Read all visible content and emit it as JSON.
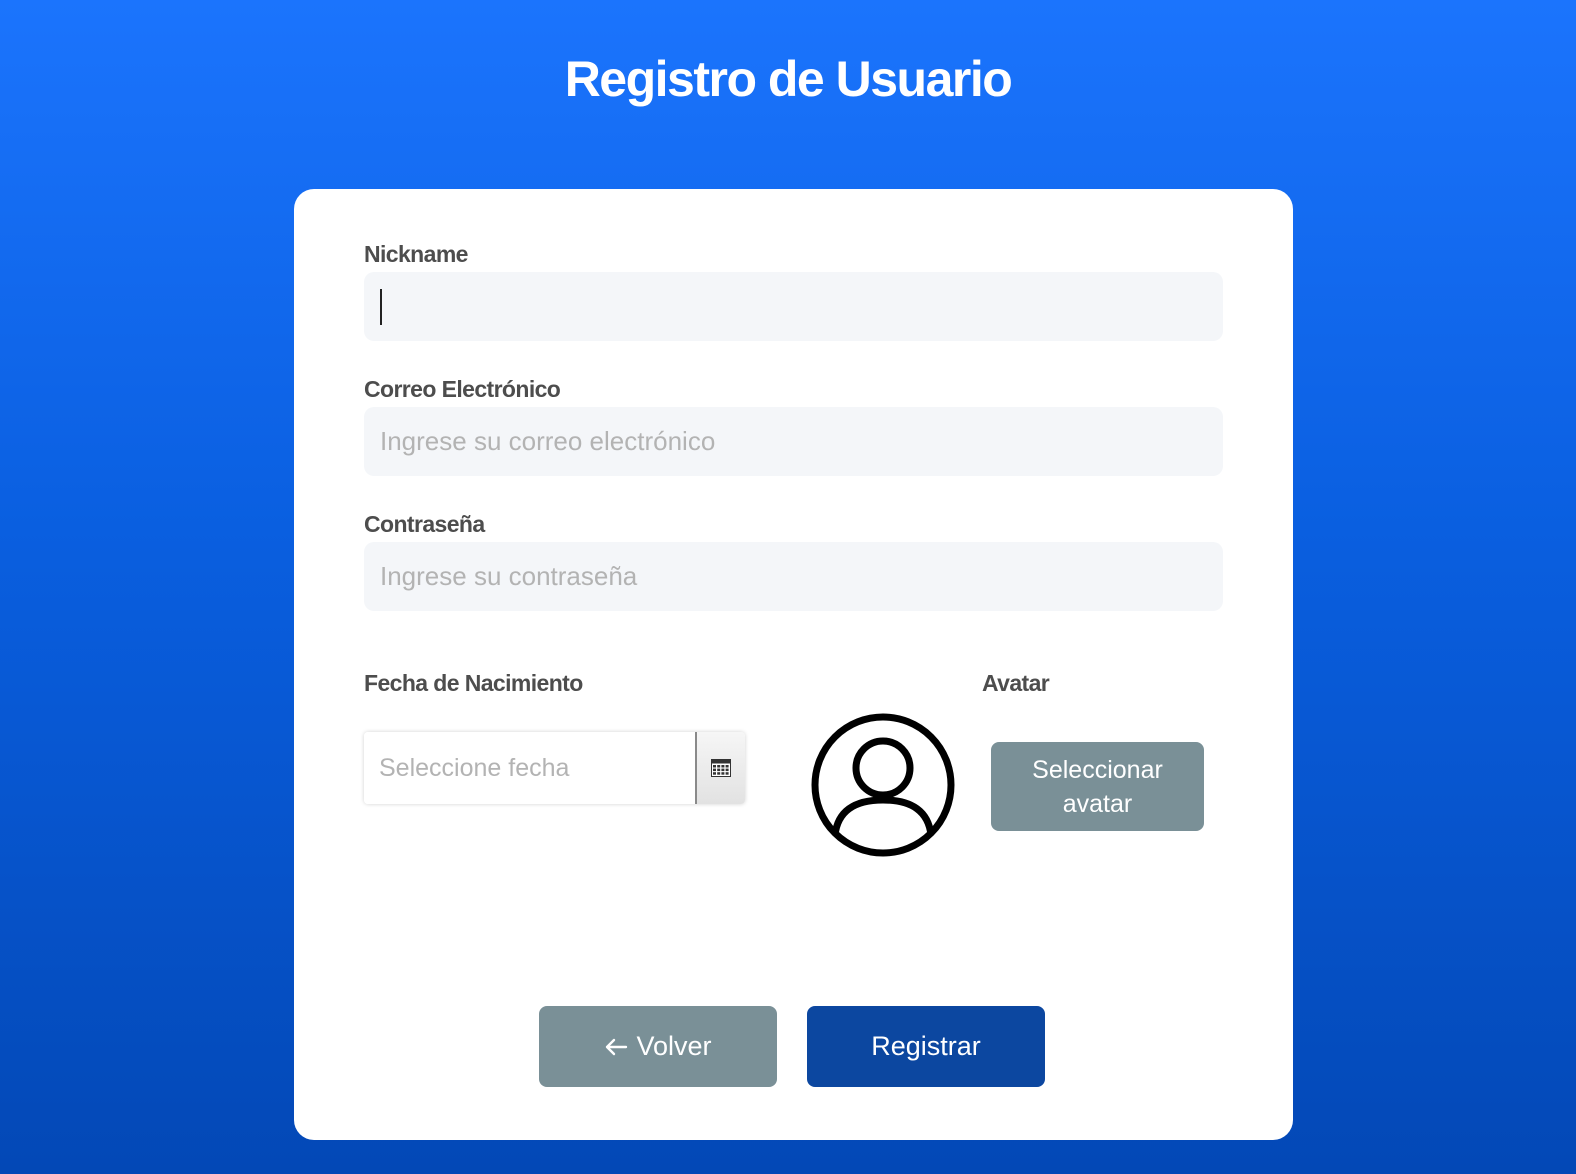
{
  "page": {
    "title": "Registro de Usuario"
  },
  "form": {
    "nickname": {
      "label": "Nickname",
      "value": "",
      "placeholder": ""
    },
    "email": {
      "label": "Correo Electrónico",
      "value": "",
      "placeholder": "Ingrese su correo electrónico"
    },
    "password": {
      "label": "Contraseña",
      "value": "",
      "placeholder": "Ingrese su contraseña"
    },
    "birthdate": {
      "label": "Fecha de Nacimiento",
      "value": "",
      "placeholder": "Seleccione fecha",
      "icon": "calendar-icon"
    },
    "avatar": {
      "label": "Avatar",
      "icon": "user-avatar-icon",
      "button_label": "Seleccionar avatar"
    }
  },
  "actions": {
    "back_label": "Volver",
    "back_icon": "arrow-left-icon",
    "register_label": "Registrar"
  },
  "colors": {
    "background_top": "#1b74fd",
    "background_bottom": "#0348b6",
    "secondary_button": "#7a9097",
    "primary_button": "#0c47a0",
    "input_background": "#f4f6f9"
  }
}
